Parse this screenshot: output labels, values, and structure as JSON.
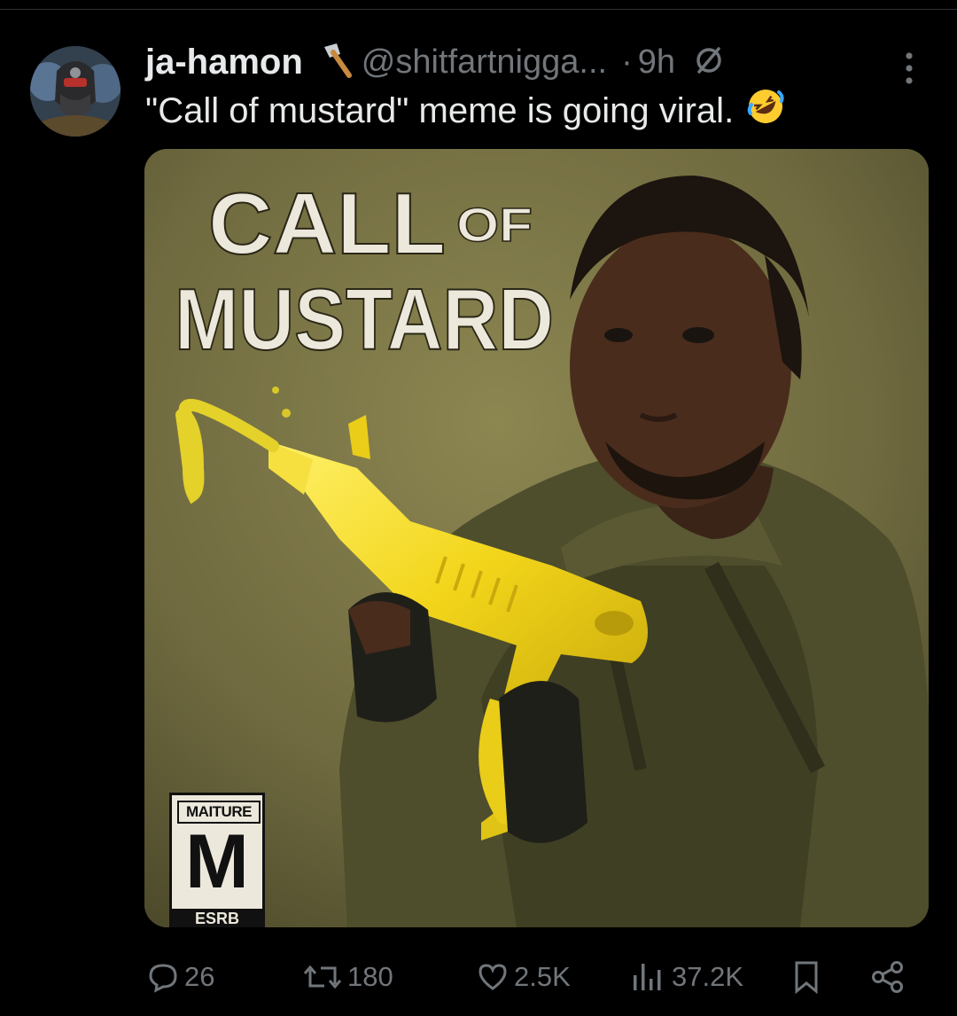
{
  "tweet": {
    "display_name": "ja-hamon",
    "name_badge_icon": "axe-icon",
    "handle": "@shitfartnigga...",
    "separator": "·",
    "time": "9h",
    "text": "\"Call of mustard\" meme is going viral.",
    "text_emoji": "rolling-on-the-floor-laughing-emoji"
  },
  "media": {
    "title_big": "CALL",
    "title_small": "OF",
    "title_line2": "MUSTARD",
    "rating_header": "MAITURE",
    "rating_letter": "M",
    "rating_footer": "ESRB"
  },
  "actions": {
    "reply_count": "26",
    "retweet_count": "180",
    "like_count": "2.5K",
    "view_count": "37.2K"
  },
  "colors": {
    "background": "#000000",
    "primary_text": "#e7e9ea",
    "secondary_text": "#71767b",
    "mustard_yellow": "#f2d51a"
  }
}
